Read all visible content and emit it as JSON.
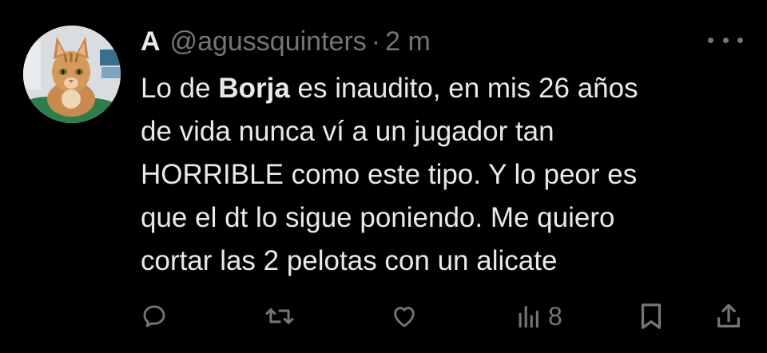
{
  "tweet": {
    "display_name": "A",
    "handle": "@agussquinters",
    "separator": "·",
    "time": "2 m",
    "text_lines": [
      {
        "pre": "Lo de ",
        "bold": "Borja",
        "post": " es inaudito, en mis 26 años"
      },
      {
        "pre": "de vida nunca ví a un jugador tan"
      },
      {
        "pre": "HORRIBLE como este tipo. Y lo peor es"
      },
      {
        "pre": "que el dt lo sigue poniendo. Me quiero"
      },
      {
        "pre": "cortar las 2 pelotas con un alicate"
      }
    ]
  },
  "actions": {
    "reply_icon": "reply-icon",
    "retweet_icon": "retweet-icon",
    "like_icon": "heart-icon",
    "views_icon": "views-bar-chart-icon",
    "views_count": "8",
    "bookmark_icon": "bookmark-icon",
    "share_icon": "share-icon"
  },
  "colors": {
    "background": "#000000",
    "text": "#e7e9ea",
    "secondary": "#71767b"
  }
}
